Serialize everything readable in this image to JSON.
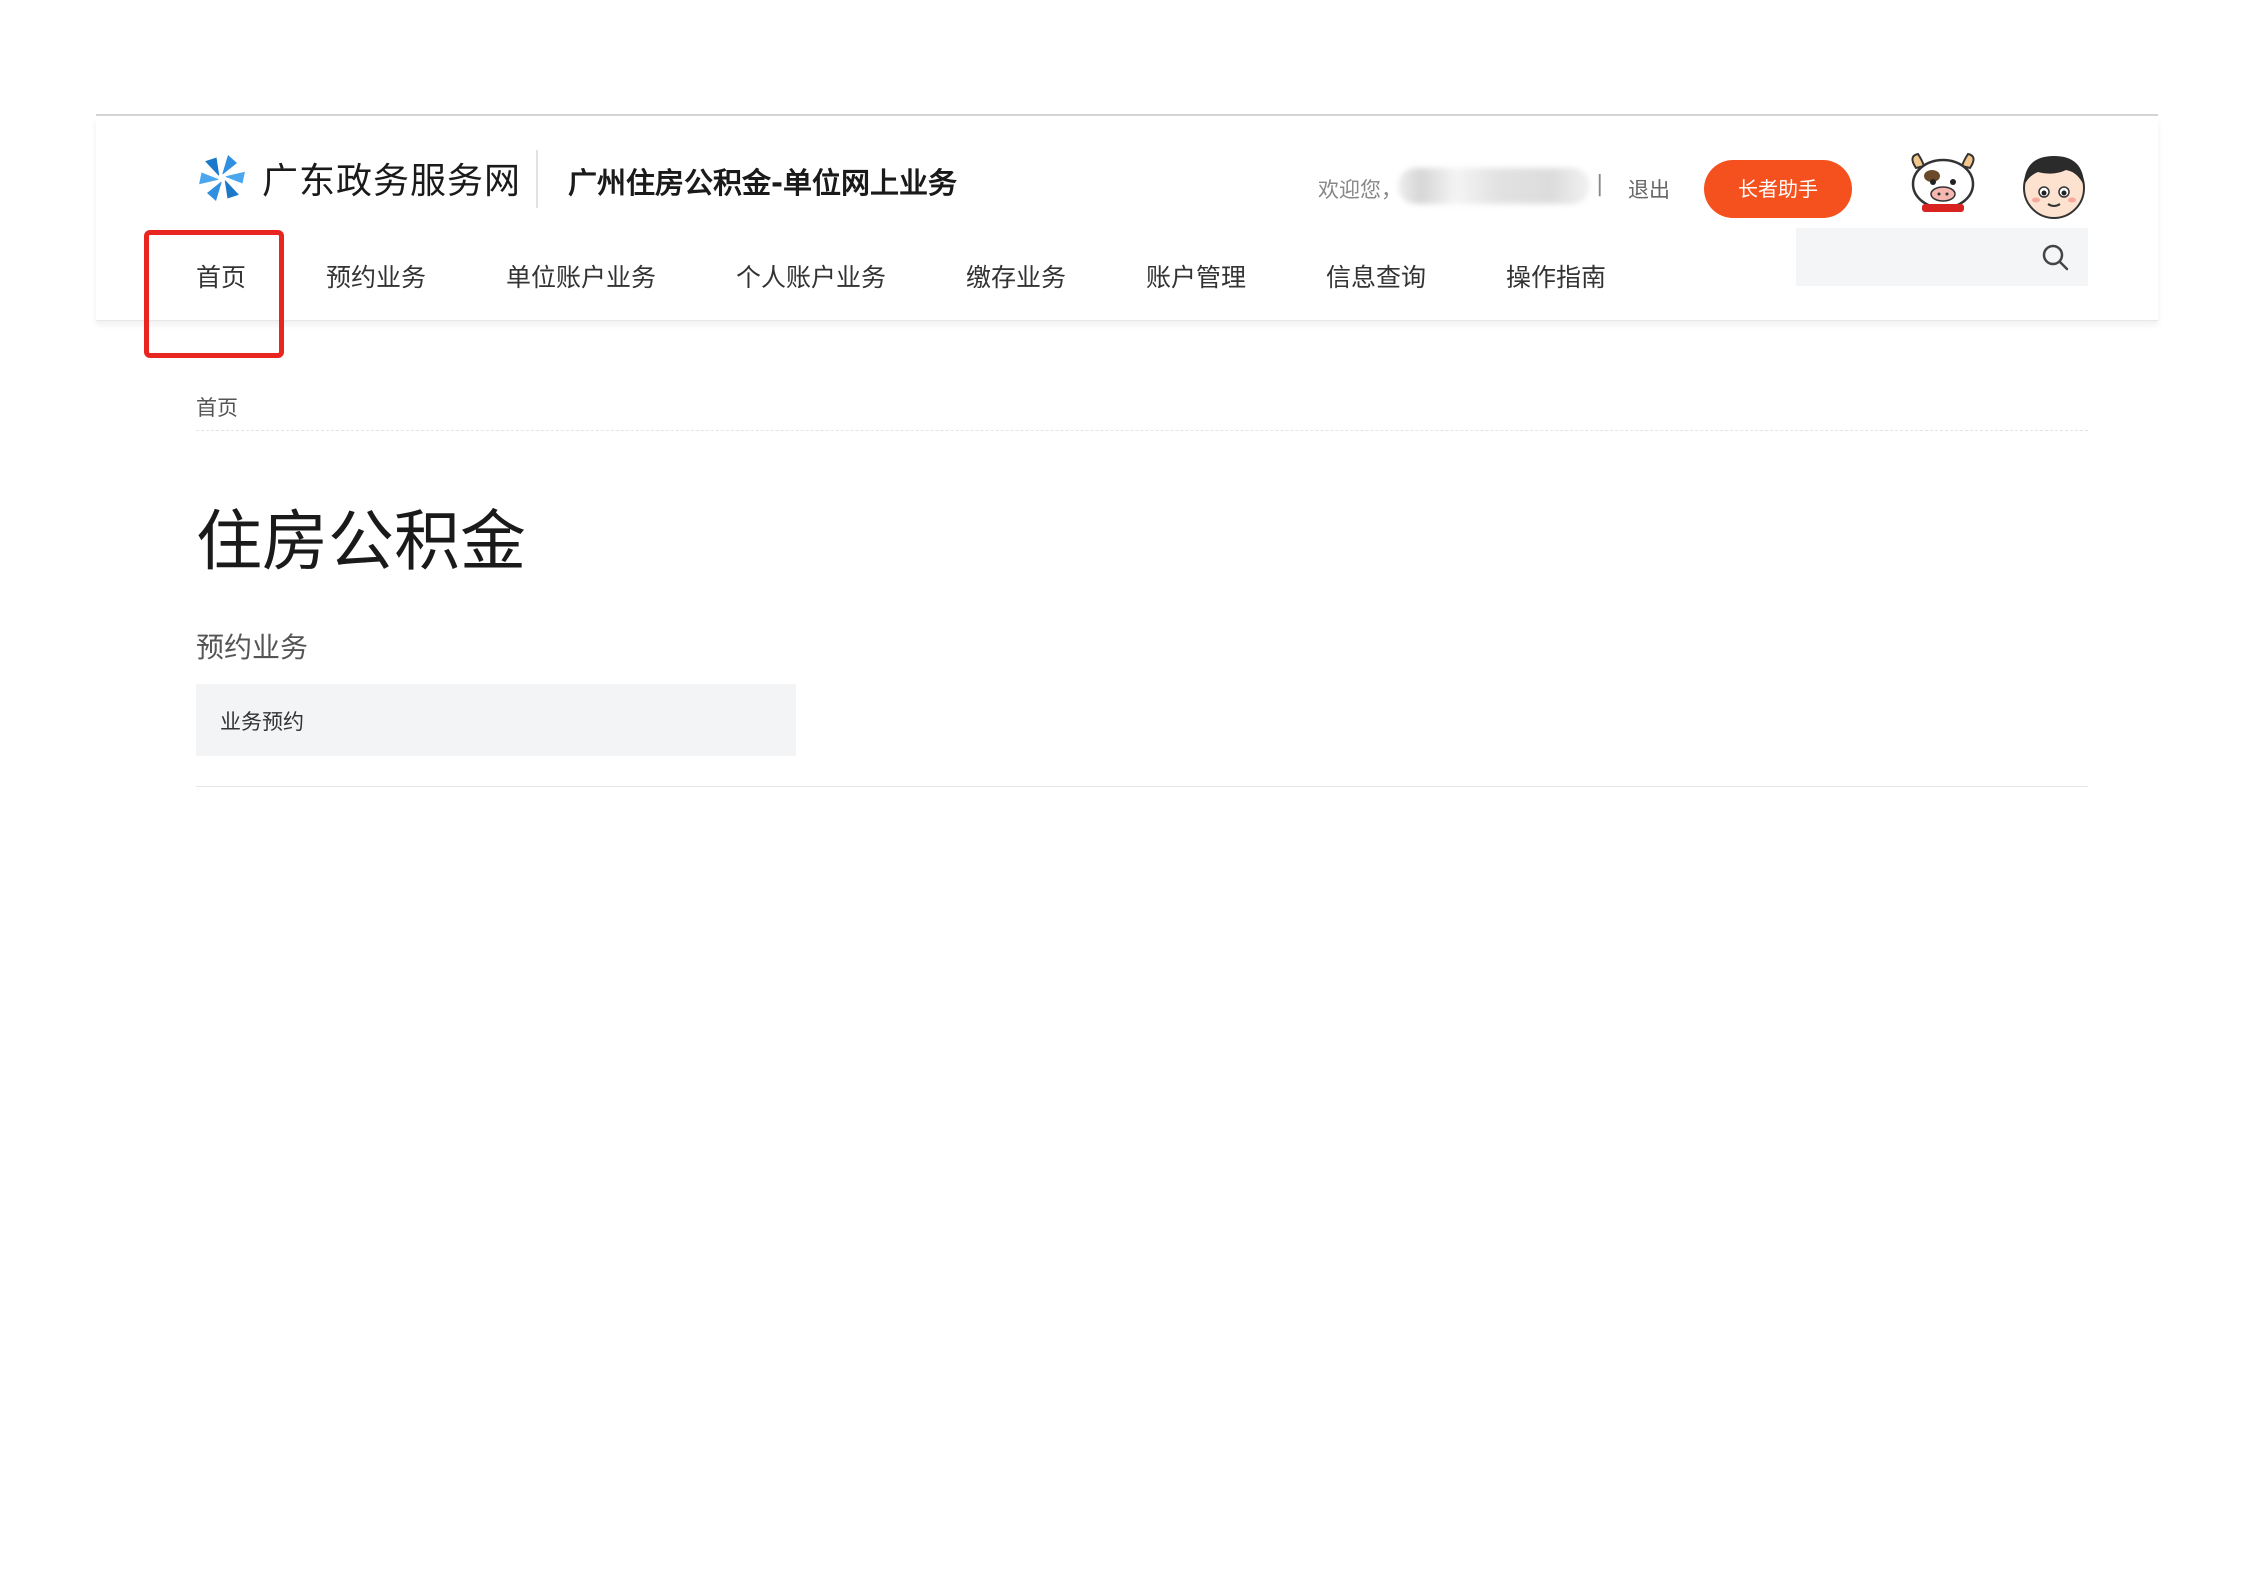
{
  "header": {
    "logo_text": "广东政务服务网",
    "site_title": "广州住房公积金-单位网上业务",
    "welcome": "欢迎您，",
    "separator": "|",
    "logout": "退出",
    "elder_button": "长者助手",
    "search_placeholder": ""
  },
  "nav": {
    "items": [
      {
        "label": "首页"
      },
      {
        "label": "预约业务"
      },
      {
        "label": "单位账户业务"
      },
      {
        "label": "个人账户业务"
      },
      {
        "label": "缴存业务"
      },
      {
        "label": "账户管理"
      },
      {
        "label": "信息查询"
      },
      {
        "label": "操作指南"
      }
    ],
    "active_index": 0
  },
  "breadcrumb": "首页",
  "main": {
    "title": "住房公积金",
    "section_title": "预约业务",
    "cards": [
      {
        "label": "业务预约"
      }
    ]
  },
  "icons": {
    "logo": "pinwheel-logo-icon",
    "search": "search-icon",
    "mascot": "cow-mascot-icon",
    "avatar": "user-avatar"
  },
  "colors": {
    "accent": "#f5511e",
    "highlight": "#e8251f",
    "logo_blue": "#2f8fe0"
  }
}
